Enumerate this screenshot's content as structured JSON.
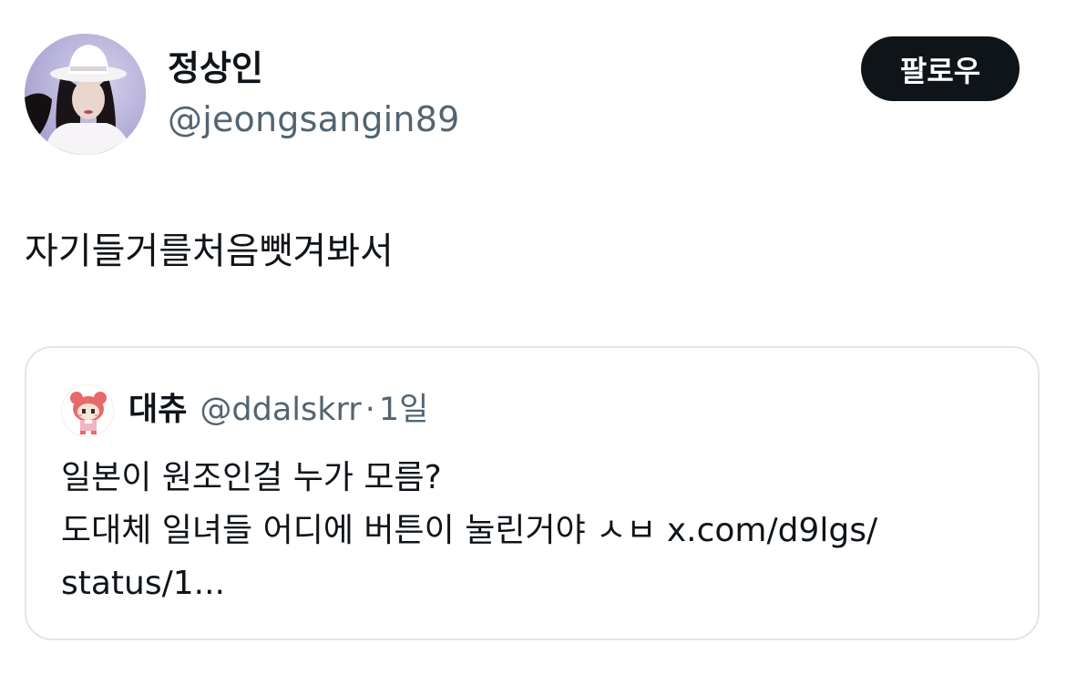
{
  "tweet": {
    "author": {
      "display_name": "정상인",
      "handle": "@jeongsangin89",
      "avatar_icon": "profile-photo-avatar"
    },
    "follow_button": {
      "label": "팔로우"
    },
    "text": "자기들거를처음뺏겨봐서",
    "quote": {
      "author": {
        "display_name": "대츄",
        "handle": "@ddalskrr",
        "avatar_icon": "pixel-character-avatar"
      },
      "separator": "·",
      "time": "1일",
      "lines": [
        "일본이 원조인걸 누가 모름?",
        "도대체 일녀들 어디에 버튼이 눌린거야 ㅅㅂ x.com/d9lgs/",
        "status/1..."
      ]
    }
  },
  "colors": {
    "primary_text": "#0f1419",
    "secondary_text": "#536471",
    "follow_button_bg": "#0f1419",
    "follow_button_text": "#ffffff",
    "card_border": "#e1e6ea"
  }
}
